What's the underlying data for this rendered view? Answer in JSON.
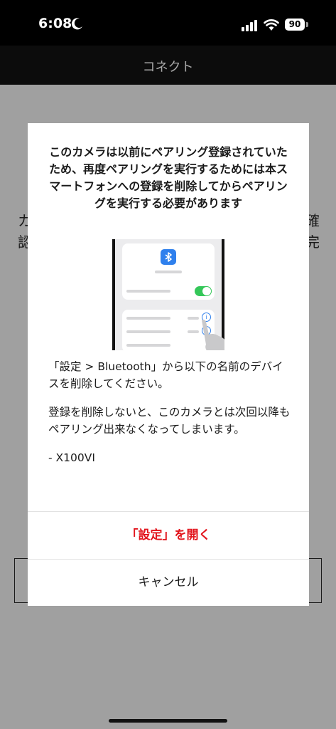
{
  "status_bar": {
    "time": "6:08",
    "battery": "90"
  },
  "nav": {
    "title": "コネクト"
  },
  "background": {
    "left_chars": [
      "カ",
      "認"
    ],
    "right_chars": [
      "確",
      "完"
    ]
  },
  "dialog": {
    "title": "このカメラは以前にペアリング登録されていたため、再度ペアリングを実行するためには本スマートフォンへの登録を削除してからペアリングを実行する必要があります",
    "instruction": "「設定 > Bluetooth」から以下の名前のデバイスを削除してください。",
    "warning": "登録を削除しないと、このカメラとは次回以降もペアリング出来なくなってしまいます。",
    "device_name": "- X100VI",
    "open_settings_label": "「設定」を開く",
    "cancel_label": "キャンセル"
  }
}
